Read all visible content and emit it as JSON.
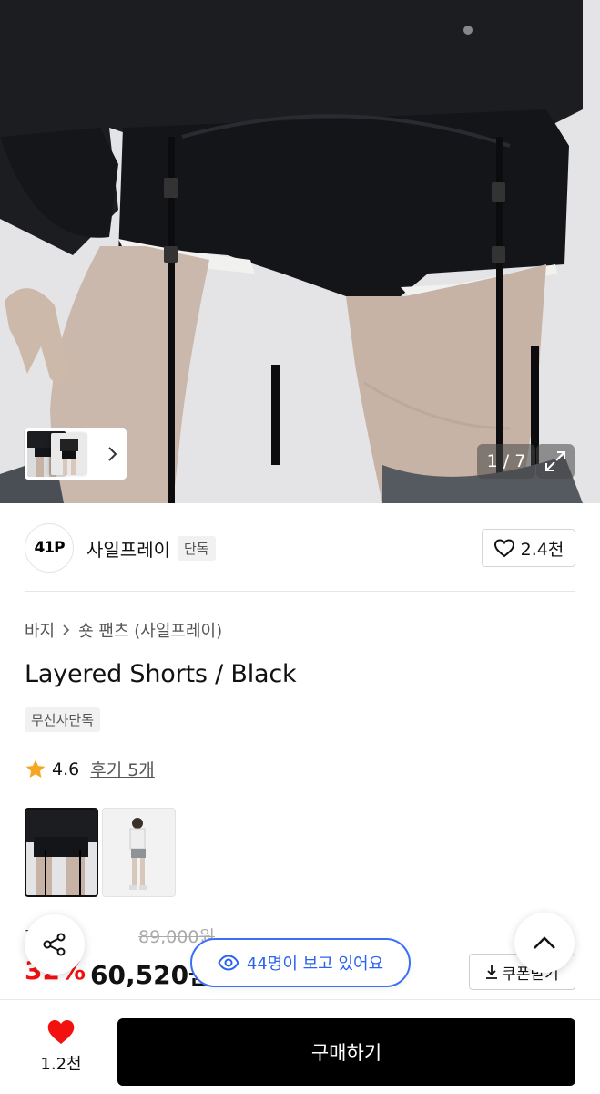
{
  "gallery": {
    "counter": "1 / 7"
  },
  "brand": {
    "logo_text": "41P",
    "name": "사일프레이",
    "badge": "단독",
    "likes": "2.4천"
  },
  "product": {
    "breadcrumb": [
      "바지",
      "숏 팬츠 (사일프레이)"
    ],
    "title": "Layered Shorts / Black",
    "tag": "무신사단독",
    "rating": "4.6",
    "review_link": "후기 5개",
    "variants": [
      "black",
      "grey"
    ]
  },
  "price": {
    "label": "정가",
    "original": "89,000원",
    "discount": "32%",
    "sale": "60,520원",
    "coupon_button": "쿠폰받기"
  },
  "viewers": {
    "text": "44명이 보고 있어요"
  },
  "bottom_bar": {
    "wish_count": "1.2천",
    "buy_label": "구매하기"
  },
  "colors": {
    "accent_red": "#f31110",
    "viewer_blue": "#2a62f2",
    "buy_button": "#000000"
  }
}
